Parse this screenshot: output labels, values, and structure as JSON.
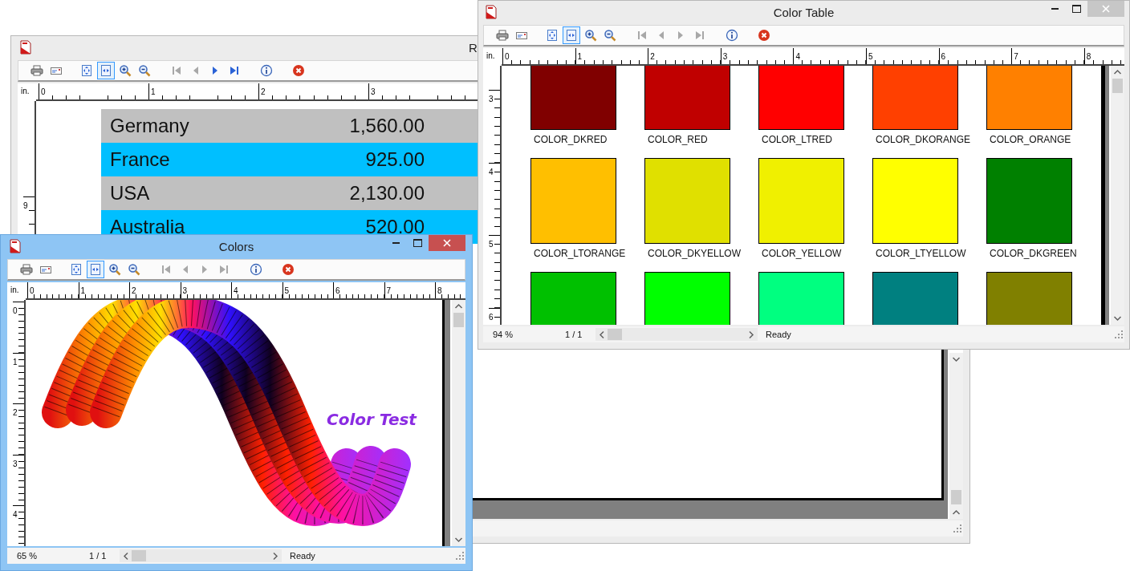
{
  "windows": [
    {
      "kind": "report",
      "title": "R",
      "active": false,
      "toolbar": [
        {
          "kind": "print",
          "selected": false,
          "disabled": false
        },
        {
          "kind": "send",
          "selected": false,
          "disabled": false
        },
        {
          "kind": "fit-page",
          "selected": false,
          "disabled": false
        },
        {
          "kind": "fit-width",
          "selected": true,
          "disabled": false
        },
        {
          "kind": "zoom-in",
          "selected": false,
          "disabled": false
        },
        {
          "kind": "zoom-out",
          "selected": false,
          "disabled": false
        },
        {
          "kind": "first",
          "selected": false,
          "disabled": true
        },
        {
          "kind": "previous",
          "selected": false,
          "disabled": true
        },
        {
          "kind": "next",
          "selected": false,
          "disabled": false
        },
        {
          "kind": "last",
          "selected": false,
          "disabled": false
        },
        {
          "kind": "info",
          "selected": false,
          "disabled": false
        },
        {
          "kind": "close",
          "selected": false,
          "disabled": false
        }
      ],
      "ruler": {
        "unit": "in.",
        "h_labels": [
          "0",
          "1",
          "2",
          "3"
        ],
        "v_labels": [
          "9"
        ]
      },
      "page": {
        "kind": "table",
        "rows": [
          {
            "name": "Germany",
            "value": "1,560.00"
          },
          {
            "name": "France",
            "value": "925.00"
          },
          {
            "name": "USA",
            "value": "2,130.00"
          },
          {
            "name": "Australia",
            "value": "520.00"
          }
        ]
      }
    },
    {
      "kind": "colortable",
      "title": "Color Table",
      "active": false,
      "toolbar": [
        {
          "kind": "print",
          "selected": false,
          "disabled": false
        },
        {
          "kind": "send",
          "selected": false,
          "disabled": false
        },
        {
          "kind": "fit-page",
          "selected": false,
          "disabled": false
        },
        {
          "kind": "fit-width",
          "selected": true,
          "disabled": false
        },
        {
          "kind": "zoom-in",
          "selected": false,
          "disabled": false
        },
        {
          "kind": "zoom-out",
          "selected": false,
          "disabled": false
        },
        {
          "kind": "first",
          "selected": false,
          "disabled": true
        },
        {
          "kind": "previous",
          "selected": false,
          "disabled": true
        },
        {
          "kind": "next",
          "selected": false,
          "disabled": true
        },
        {
          "kind": "last",
          "selected": false,
          "disabled": true
        },
        {
          "kind": "info",
          "selected": false,
          "disabled": false
        },
        {
          "kind": "close",
          "selected": false,
          "disabled": false
        }
      ],
      "ruler": {
        "unit": "in.",
        "h_labels": [
          "0",
          "1",
          "2",
          "3",
          "4",
          "5",
          "6",
          "7",
          "8"
        ],
        "v_labels": [
          "3",
          "4",
          "5",
          "6"
        ]
      },
      "page": {
        "kind": "swatches",
        "swatches": [
          {
            "label": "COLOR_DKRED",
            "color": "#800000"
          },
          {
            "label": "COLOR_RED",
            "color": "#c00000"
          },
          {
            "label": "COLOR_LTRED",
            "color": "#ff0000"
          },
          {
            "label": "COLOR_DKORANGE",
            "color": "#ff4000"
          },
          {
            "label": "COLOR_ORANGE",
            "color": "#ff8000"
          },
          {
            "label": "COLOR_LTORANGE",
            "color": "#ffbf00"
          },
          {
            "label": "COLOR_DKYELLOW",
            "color": "#e0e000"
          },
          {
            "label": "COLOR_YELLOW",
            "color": "#f0f000"
          },
          {
            "label": "COLOR_LTYELLOW",
            "color": "#ffff00"
          },
          {
            "label": "COLOR_DKGREEN",
            "color": "#008000"
          },
          {
            "color": "#00c000"
          },
          {
            "color": "#00ff00"
          },
          {
            "color": "#00ff80"
          },
          {
            "color": "#008080"
          },
          {
            "color": "#808000"
          }
        ]
      },
      "status_bar": {
        "zoom": "94 %",
        "page": "1 / 1",
        "status": "Ready"
      }
    },
    {
      "kind": "colors",
      "title": "Colors",
      "active": true,
      "toolbar": [
        {
          "kind": "print",
          "selected": false,
          "disabled": false
        },
        {
          "kind": "send",
          "selected": false,
          "disabled": false
        },
        {
          "kind": "fit-page",
          "selected": false,
          "disabled": false
        },
        {
          "kind": "fit-width",
          "selected": true,
          "disabled": false
        },
        {
          "kind": "zoom-in",
          "selected": false,
          "disabled": false
        },
        {
          "kind": "zoom-out",
          "selected": false,
          "disabled": false
        },
        {
          "kind": "first",
          "selected": false,
          "disabled": true
        },
        {
          "kind": "previous",
          "selected": false,
          "disabled": true
        },
        {
          "kind": "next",
          "selected": false,
          "disabled": true
        },
        {
          "kind": "last",
          "selected": false,
          "disabled": true
        },
        {
          "kind": "info",
          "selected": false,
          "disabled": false
        },
        {
          "kind": "close",
          "selected": false,
          "disabled": false
        }
      ],
      "ruler": {
        "unit": "in.",
        "h_labels": [
          "0",
          "1",
          "2",
          "3",
          "4",
          "5",
          "6",
          "7",
          "8"
        ],
        "v_labels": [
          "0",
          "1",
          "2",
          "3",
          "4"
        ]
      },
      "page": {
        "kind": "art",
        "text": "Color Test"
      },
      "status_bar": {
        "zoom": "65 %",
        "page": "1 / 1",
        "status": "Ready"
      }
    }
  ]
}
